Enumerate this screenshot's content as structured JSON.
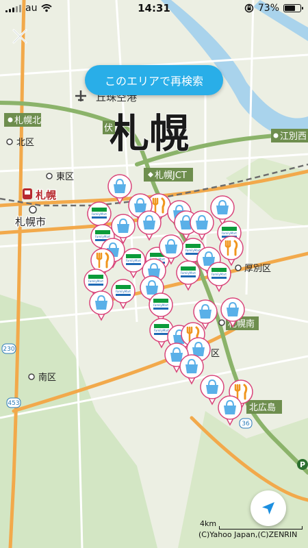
{
  "status_bar": {
    "carrier": "au",
    "time": "14:31",
    "battery": "73%",
    "battery_level": 0.73
  },
  "map": {
    "big_label": "札幌",
    "labels": {
      "airport": "丘珠空港",
      "sapporo_kita": "札幌北",
      "kita_ku": "北区",
      "higashi_ku": "東区",
      "sapporo_station": "札幌",
      "sapporo_shi": "札幌市",
      "fushiko": "伏",
      "sapporo_jct": "札幌JCT",
      "ebetsu_nishi": "江別西",
      "atsubetsu_ku": "厚別区",
      "sapporo_minami": "札幌南",
      "minami_ku": "南区",
      "kitahiroshima": "北広島",
      "ku": "区"
    },
    "road_numbers": [
      "230",
      "453",
      "36"
    ],
    "poi_types": {
      "bag": "shopping-bag-icon",
      "food": "fork-knife-icon",
      "familymart": "familymart-logo"
    },
    "familymart_text": "FamilyMart",
    "colors": {
      "pin_border": "#d9457a",
      "bag_blue": "#5ab0e8",
      "food_orange": "#f0961e",
      "fm_green": "#0c9b3a",
      "fm_blue": "#1f6ab5",
      "road_major": "#f2a94b",
      "expressway": "#8bb36a",
      "water": "#a9d3ec"
    }
  },
  "controls": {
    "search_area_button": "このエリアで再検索",
    "close": "close-icon",
    "locate": "location-arrow-icon"
  },
  "scale": "4km",
  "copyright": "(C)Yahoo Japan,(C)ZENRIN"
}
